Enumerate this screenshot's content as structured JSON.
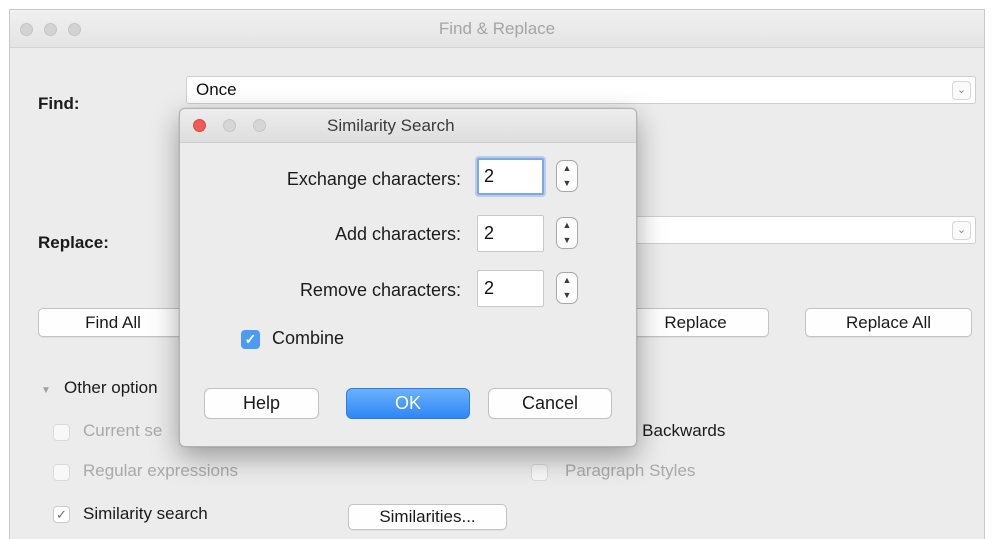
{
  "window": {
    "title": "Find & Replace",
    "find_label": "Find:",
    "find_value": "Once",
    "replace_label": "Replace:",
    "replace_value": "",
    "buttons": {
      "find_all": "Find All",
      "replace": "Replace",
      "replace_all": "Replace All"
    },
    "other_options_label": "Other option",
    "options": {
      "current_selection": "Current se",
      "regular_expressions": "Regular expressions",
      "similarity_search": "Similarity search",
      "similarity_search_checked": true,
      "similarities_button": "Similarities...",
      "backwards": "e Backwards",
      "paragraph_styles": "Paragraph Styles"
    }
  },
  "dialog": {
    "title": "Similarity Search",
    "exchange_label": "Exchange characters:",
    "exchange_value": "2",
    "add_label": "Add characters:",
    "add_value": "2",
    "remove_label": "Remove characters:",
    "remove_value": "2",
    "combine_label": "Combine",
    "combine_checked": true,
    "help_button": "Help",
    "ok_button": "OK",
    "cancel_button": "Cancel"
  },
  "colors": {
    "accent": "#3a8ff5",
    "close_red": "#ec5d56",
    "focus_ring": "#7fa7e0"
  }
}
